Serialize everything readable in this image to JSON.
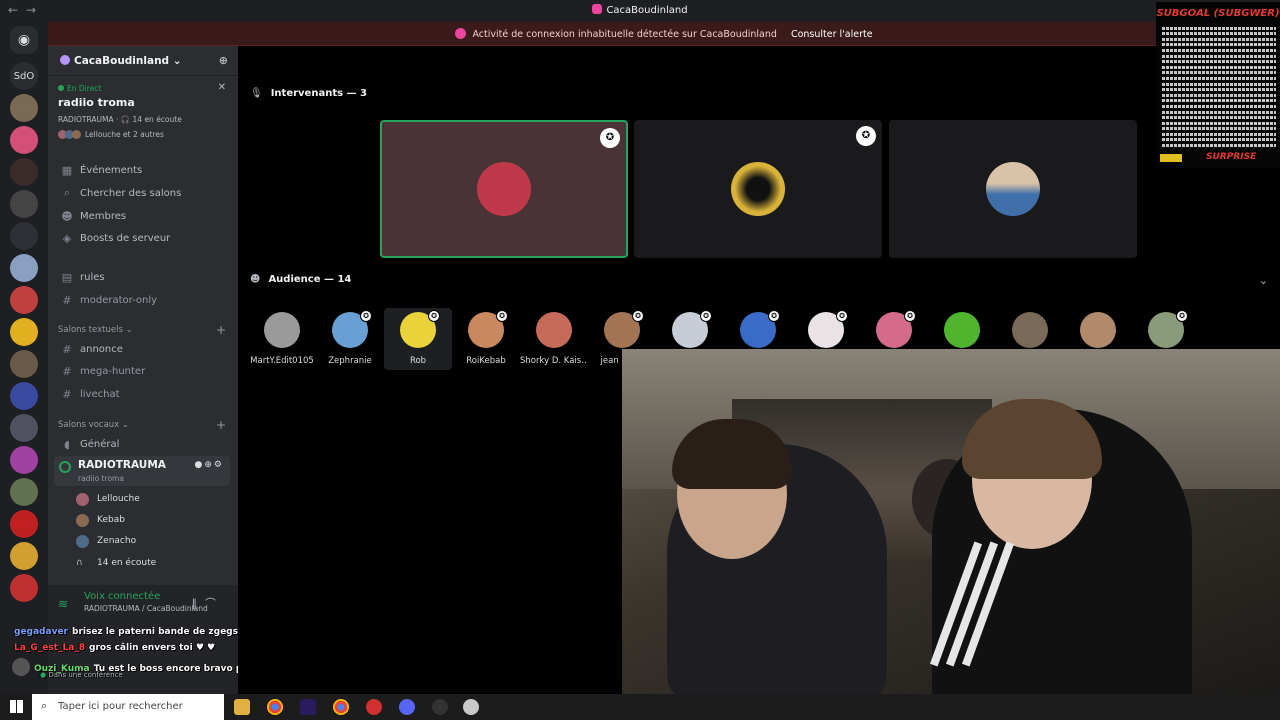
{
  "window": {
    "title": "CacaBoudinland"
  },
  "alert": {
    "message": "Activité de connexion inhabituelle détectée sur CacaBoudinland",
    "action": "Consulter l'alerte"
  },
  "rail": {
    "text_server": "SdO"
  },
  "guild": {
    "name": "CacaBoudinland ⌄"
  },
  "stage_card": {
    "live": "En Direct",
    "name": "radiio troma",
    "meta": "RADIOTRAUMA · 🎧 14 en écoute",
    "listeners": "Lellouche et 2 autres"
  },
  "nav": [
    {
      "icon": "calendar-icon",
      "label": "Événements"
    },
    {
      "icon": "search-icon",
      "label": "Chercher des salons"
    },
    {
      "icon": "members-icon",
      "label": "Membres"
    },
    {
      "icon": "boost-icon",
      "label": "Boosts de serveur"
    }
  ],
  "channels_top": [
    {
      "label": "rules"
    },
    {
      "label": "moderator-only"
    }
  ],
  "categories": {
    "text": "Salons textuels ⌄",
    "voice": "Salons vocaux ⌄"
  },
  "text_channels": [
    {
      "label": "annonce"
    },
    {
      "label": "mega-hunter"
    },
    {
      "label": "livechat"
    }
  ],
  "voice_channels": [
    {
      "label": "Général"
    }
  ],
  "active_voice": {
    "name": "RADIOTRAUMA",
    "sub": "radiio troma"
  },
  "voice_members": [
    {
      "name": "Lellouche",
      "color": "#a0626e"
    },
    {
      "name": "Kebab",
      "color": "#8a6a52"
    },
    {
      "name": "Zenacho",
      "color": "#4f6b8a"
    }
  ],
  "listen_count": "14 en écoute",
  "voice_panel": {
    "title": "Voix connectée",
    "sub": "RADIOTRAUMA / CacaBoudinland"
  },
  "chat": [
    {
      "user": "gegadaver",
      "color": "#7aa0ff",
      "text": "brisez le paterni bande de zgegs"
    },
    {
      "user": "La_G_est_La_8",
      "color": "#ff4040",
      "text": "gros câlin envers toi ♥ ♥"
    },
    {
      "user": "Ouzi_Kuma",
      "color": "#6bdc6b",
      "text": "Tu est le boss encore bravo pour ton courage"
    }
  ],
  "user_status": "Dans une conférence",
  "speakers_header": "Intervenants — 3",
  "audience_header": "Audience — 14",
  "speakers": [
    {
      "color": "#c0394a",
      "speaking": true
    },
    {
      "color": "#d9b23a",
      "speaking": false
    },
    {
      "color": "#3e6fa8",
      "speaking": false
    }
  ],
  "audience": [
    {
      "name": "MartY.Edit0105",
      "color": "#9a9a9a"
    },
    {
      "name": "Zephranie",
      "color": "#6a9fd3"
    },
    {
      "name": "Rob",
      "color": "#e9d23a"
    },
    {
      "name": "RoiKebab",
      "color": "#c9885f"
    },
    {
      "name": "Shorky D. Kais…",
      "color": "#c66a5a"
    },
    {
      "name": "jean ma…",
      "color": "#a37555"
    },
    {
      "name": "",
      "color": "#c8ccd4"
    },
    {
      "name": "",
      "color": "#3a6bc9"
    },
    {
      "name": "",
      "color": "#e9e3e6"
    },
    {
      "name": "",
      "color": "#d46b8a"
    },
    {
      "name": "",
      "color": "#4fb52f"
    },
    {
      "name": "",
      "color": "#7a6a5a"
    },
    {
      "name": "",
      "color": "#b08a6a"
    },
    {
      "name": "",
      "color": "#8a9a7a"
    }
  ],
  "overlay": {
    "title": "SUBGOAL (SUBGWER)",
    "surprise": "SURPRISE"
  },
  "taskbar": {
    "search_placeholder": "Taper ici pour rechercher"
  }
}
